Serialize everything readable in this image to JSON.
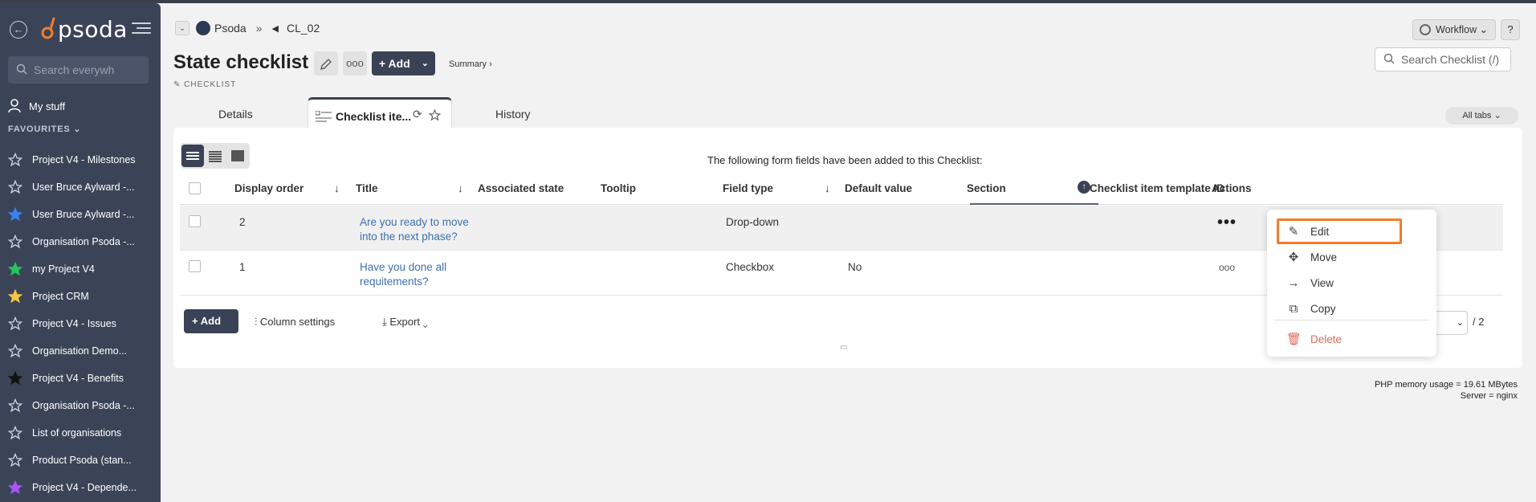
{
  "sidebar": {
    "logo_text": "psoda",
    "search_placeholder": "Search everywh",
    "my_stuff": "My stuff",
    "favourites_label": "FAVOURITES",
    "favourites_chevron": "⌄",
    "items": [
      {
        "label": "Project V4 - Milestones",
        "star_color": "#ffffff",
        "filled": false
      },
      {
        "label": "User Bruce Aylward -...",
        "star_color": "#ffffff",
        "filled": false
      },
      {
        "label": "User Bruce Aylward -...",
        "star_color": "#3b82f6",
        "filled": true
      },
      {
        "label": "Organisation Psoda -...",
        "star_color": "#ffffff",
        "filled": false
      },
      {
        "label": "my Project V4",
        "star_color": "#22c55e",
        "filled": true
      },
      {
        "label": "Project CRM",
        "star_color": "#f5c542",
        "filled": true
      },
      {
        "label": "Project V4 - Issues",
        "star_color": "#ffffff",
        "filled": false
      },
      {
        "label": "Organisation Demo...",
        "star_color": "#ffffff",
        "filled": false
      },
      {
        "label": "Project V4 - Benefits",
        "star_color": "#111111",
        "filled": true
      },
      {
        "label": "Organisation Psoda -...",
        "star_color": "#ffffff",
        "filled": false
      },
      {
        "label": "List of organisations",
        "star_color": "#ffffff",
        "filled": false
      },
      {
        "label": "Product Psoda (stan...",
        "star_color": "#ffffff",
        "filled": false
      },
      {
        "label": "Project V4 - Depende...",
        "star_color": "#a855f7",
        "filled": true
      }
    ]
  },
  "breadcrumb": {
    "root": "Psoda",
    "separator": "»",
    "current": "CL_02"
  },
  "header": {
    "title": "State checklist",
    "subtitle": "CHECKLIST",
    "add_label": "Add",
    "summary_label": "Summary ›",
    "search_placeholder": "Search Checklist (/)",
    "workflow_label": "Workflow ⌄",
    "help_label": "?"
  },
  "tabs": {
    "details": "Details",
    "checklist_items": "Checklist ite...",
    "history": "History",
    "all_tabs": "All tabs ⌄"
  },
  "panel": {
    "note": "The following form fields have been added to this Checklist:",
    "columns": [
      "Display order",
      "Title",
      "Associated state",
      "Tooltip",
      "Field type",
      "Default value",
      "Section",
      "Checklist item template ID",
      "Actions"
    ],
    "rows": [
      {
        "display_order": "2",
        "title": "Are you ready to move into the next phase?",
        "associated_state": "",
        "tooltip": "",
        "field_type": "Drop-down",
        "default_value": "",
        "section": "",
        "template_id": ""
      },
      {
        "display_order": "1",
        "title": "Have you done all requitements?",
        "associated_state": "",
        "tooltip": "",
        "field_type": "Checkbox",
        "default_value": "No",
        "section": "",
        "template_id": ""
      }
    ],
    "footer": {
      "add_label": "Add",
      "column_settings": "Column settings",
      "export": "Export",
      "page_total": "/ 2"
    }
  },
  "context_menu": {
    "items": {
      "edit": "Edit",
      "move": "Move",
      "view": "View",
      "copy": "Copy",
      "delete": "Delete"
    },
    "highlight_color": "#f07d2c",
    "delete_color": "#e06a5a"
  },
  "footer_info": {
    "memory": "PHP memory usage = 19.61 MBytes",
    "server": "Server = nginx"
  }
}
